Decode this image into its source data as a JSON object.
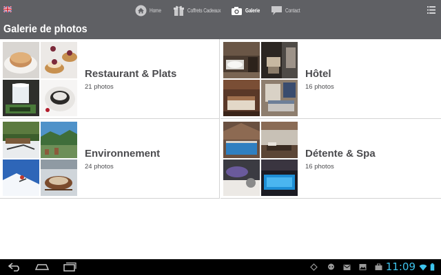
{
  "header": {
    "page_title": "Galerie de photos",
    "nav": [
      {
        "label": "Home",
        "icon": "home-icon"
      },
      {
        "label": "Coffrets Cadeaux",
        "icon": "gift-icon"
      },
      {
        "label": "Galerie",
        "icon": "camera-icon",
        "active": true
      },
      {
        "label": "Contact",
        "icon": "chat-bubble-icon"
      }
    ],
    "language_icon": "uk-flag-icon",
    "menu_icon": "menu-list-icon"
  },
  "gallery": [
    {
      "title": "Restaurant & Plats",
      "count": "21 photos"
    },
    {
      "title": "Hôtel",
      "count": "16 photos"
    },
    {
      "title": "Environnement",
      "count": "24 photos"
    },
    {
      "title": "Détente & Spa",
      "count": "16 photos"
    }
  ],
  "system_bar": {
    "clock": "11:09",
    "accent_color": "#3ec5ee",
    "buttons": [
      "back-icon",
      "home-icon",
      "recent-apps-icon"
    ],
    "status_icons": [
      "gps-icon",
      "chat-icon",
      "mail-icon",
      "gallery-icon",
      "briefcase-icon",
      "wifi-icon",
      "battery-icon"
    ]
  },
  "colors": {
    "header_bg": "#5f6064",
    "title_text": "#4b4b4e"
  }
}
